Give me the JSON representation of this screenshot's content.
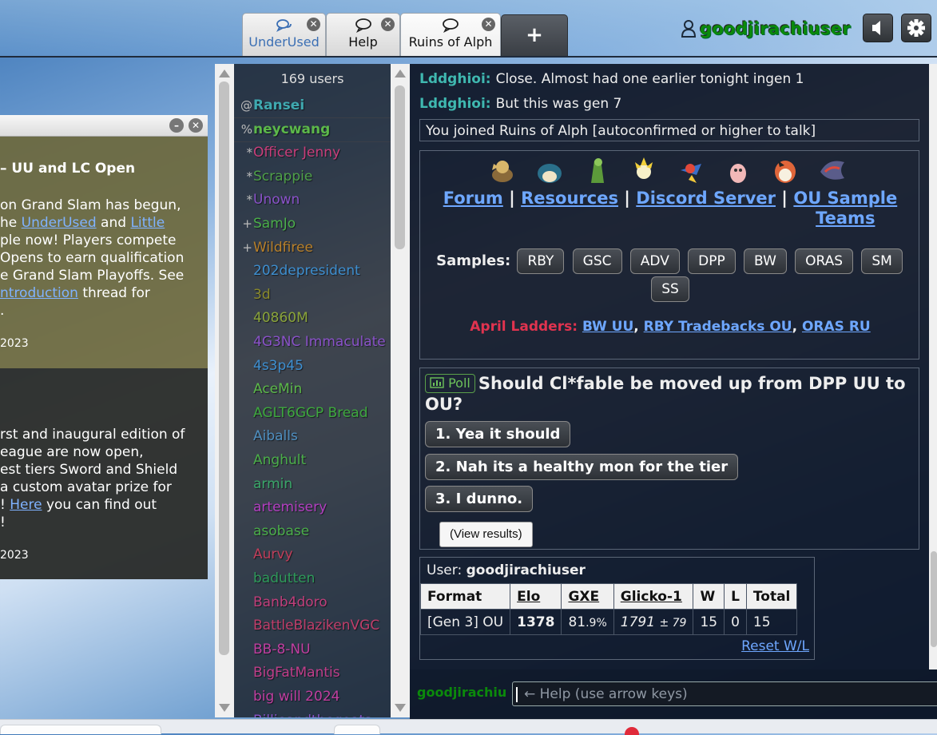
{
  "header": {
    "tabs": [
      {
        "label": "UnderUsed",
        "icon": "chat-bubbles-icon"
      },
      {
        "label": "Help",
        "icon": "chat-bubble-icon"
      },
      {
        "label": "Ruins of Alph",
        "icon": "chat-bubble-icon"
      }
    ],
    "add_tab_label": "+",
    "username": "goodjirachiuser",
    "icons": {
      "user": "user-icon",
      "sound": "speaker-icon",
      "settings": "gear-icon"
    }
  },
  "news": {
    "item1": {
      "title": "– UU and LC Open",
      "lines": [
        {
          "pre": "on Grand Slam has begun,",
          "link": "",
          "mid": "",
          "link2": "",
          "post": ""
        },
        {
          "pre": "he ",
          "link": "UnderUsed",
          "mid": " and ",
          "link2": "Little",
          "post": ""
        },
        {
          "pre": "ple now! Players compete",
          "link": "",
          "mid": "",
          "link2": "",
          "post": ""
        },
        {
          "pre": "Opens to earn qualification",
          "link": "",
          "mid": "",
          "link2": "",
          "post": ""
        },
        {
          "pre": "e Grand Slam Playoffs. See",
          "link": "",
          "mid": "",
          "link2": "",
          "post": ""
        },
        {
          "pre": "",
          "link": "ntroduction",
          "mid": " thread for",
          "link2": "",
          "post": ""
        },
        {
          "pre": ".",
          "link": "",
          "mid": "",
          "link2": "",
          "post": ""
        }
      ],
      "date": "2023"
    },
    "item2": {
      "lines": [
        {
          "pre": "rst and inaugural edition of",
          "link": "",
          "post": ""
        },
        {
          "pre": "eague are now open,",
          "link": "",
          "post": ""
        },
        {
          "pre": "est tiers Sword and Shield",
          "link": "",
          "post": ""
        },
        {
          "pre": "a custom avatar prize for",
          "link": "",
          "post": ""
        },
        {
          "pre": "! ",
          "link": "Here",
          "post": " you can find out"
        },
        {
          "pre": "!",
          "link": "",
          "post": ""
        }
      ],
      "date": "2023"
    }
  },
  "userlist": {
    "count_label": "169 users",
    "users": [
      {
        "rank": "@",
        "name": "Ransei",
        "color": "#3fa9b0",
        "bold": true
      },
      {
        "rank": "%",
        "name": "neycwang",
        "color": "#5cb84a",
        "bold": true
      },
      {
        "rank": "*",
        "name": "Officer Jenny",
        "color": "#c93e7a",
        "bold": false
      },
      {
        "rank": "*",
        "name": "Scrappie",
        "color": "#4fa049",
        "bold": false
      },
      {
        "rank": "*",
        "name": "Unown",
        "color": "#8a52c9",
        "bold": false
      },
      {
        "rank": "+",
        "name": "SamJo",
        "color": "#4bae4a",
        "bold": false
      },
      {
        "rank": "+",
        "name": "Wildfiree",
        "color": "#b8802a",
        "bold": false
      },
      {
        "rank": "",
        "name": "202depresident",
        "color": "#3e8fd0",
        "bold": false
      },
      {
        "rank": "",
        "name": "3d",
        "color": "#8a8a2a",
        "bold": false
      },
      {
        "rank": "",
        "name": "40860M",
        "color": "#8aa43a",
        "bold": false
      },
      {
        "rank": "",
        "name": "4G3NC Immaculate",
        "color": "#8a52c9",
        "bold": false
      },
      {
        "rank": "",
        "name": "4s3p45",
        "color": "#3e8fd0",
        "bold": false
      },
      {
        "rank": "",
        "name": "AceMin",
        "color": "#5cb84a",
        "bold": false
      },
      {
        "rank": "",
        "name": "AGLT6GCP Bread",
        "color": "#3ea83e",
        "bold": false
      },
      {
        "rank": "",
        "name": "Aiballs",
        "color": "#4f8fc0",
        "bold": false
      },
      {
        "rank": "",
        "name": "Anghult",
        "color": "#4bae4a",
        "bold": false
      },
      {
        "rank": "",
        "name": "armin",
        "color": "#3aa86a",
        "bold": false
      },
      {
        "rank": "",
        "name": "artemisery",
        "color": "#b23ec0",
        "bold": false
      },
      {
        "rank": "",
        "name": "asobase",
        "color": "#4bae4a",
        "bold": false
      },
      {
        "rank": "",
        "name": "Aurvy",
        "color": "#c03e5a",
        "bold": false
      },
      {
        "rank": "",
        "name": "badutten",
        "color": "#2e9a5a",
        "bold": false
      },
      {
        "rank": "",
        "name": "Banb4doro",
        "color": "#c03e7a",
        "bold": false
      },
      {
        "rank": "",
        "name": "BattleBlazikenVGC",
        "color": "#c03e6a",
        "bold": false
      },
      {
        "rank": "",
        "name": "BB-8-NU",
        "color": "#c03ea0",
        "bold": false
      },
      {
        "rank": "",
        "name": "BigFatMantis",
        "color": "#c03e8a",
        "bold": false
      },
      {
        "rank": "",
        "name": "big will 2024",
        "color": "#c03ea0",
        "bold": false
      },
      {
        "rank": "",
        "name": "Billieandthegoats",
        "color": "#8a52c9",
        "bold": false
      }
    ]
  },
  "chat": {
    "messages": [
      {
        "user": "Lddghioi:",
        "text": "Close. Almost had one earlier tonight ingen 1"
      },
      {
        "user": "Lddghioi:",
        "text": "But this was gen 7"
      }
    ],
    "notice": "You joined Ruins of Alph [autoconfirmed or higher to talk]",
    "infobox": {
      "links": [
        "Forum",
        "Resources",
        "Discord Server",
        "OU Sample Teams"
      ],
      "separator": "|",
      "samples_label": "Samples:",
      "samples": [
        "RBY",
        "GSC",
        "ADV",
        "DPP",
        "BW",
        "ORAS",
        "SM",
        "SS"
      ],
      "ladders_label": "April Ladders:",
      "ladders": [
        "BW UU",
        "RBY Tradebacks OU",
        "ORAS RU"
      ],
      "ladder_sep": ","
    },
    "poll": {
      "badge": "Poll",
      "question": "Should Cl*fable be moved up from DPP UU to OU?",
      "options": [
        "1. Yea it should",
        "2. Nah its a healthy mon for the tier",
        "3. I dunno."
      ],
      "view_results": "(View results)"
    },
    "ranking": {
      "user_label": "User:",
      "user": "goodjirachiuser",
      "headers": [
        "Format",
        "Elo",
        "GXE",
        "Glicko-1",
        "W",
        "L",
        "Total"
      ],
      "row": {
        "format": "[Gen 3] OU",
        "elo": "1378",
        "gxe_main": "81",
        "gxe_dec": ".9%",
        "glicko": "1791",
        "glicko_dev": "± 79",
        "w": "15",
        "l": "0",
        "total": "15"
      },
      "reset": "Reset W/L"
    },
    "input_user": "goodjirachiuser",
    "input_placeholder": "← Help (use arrow keys)"
  }
}
